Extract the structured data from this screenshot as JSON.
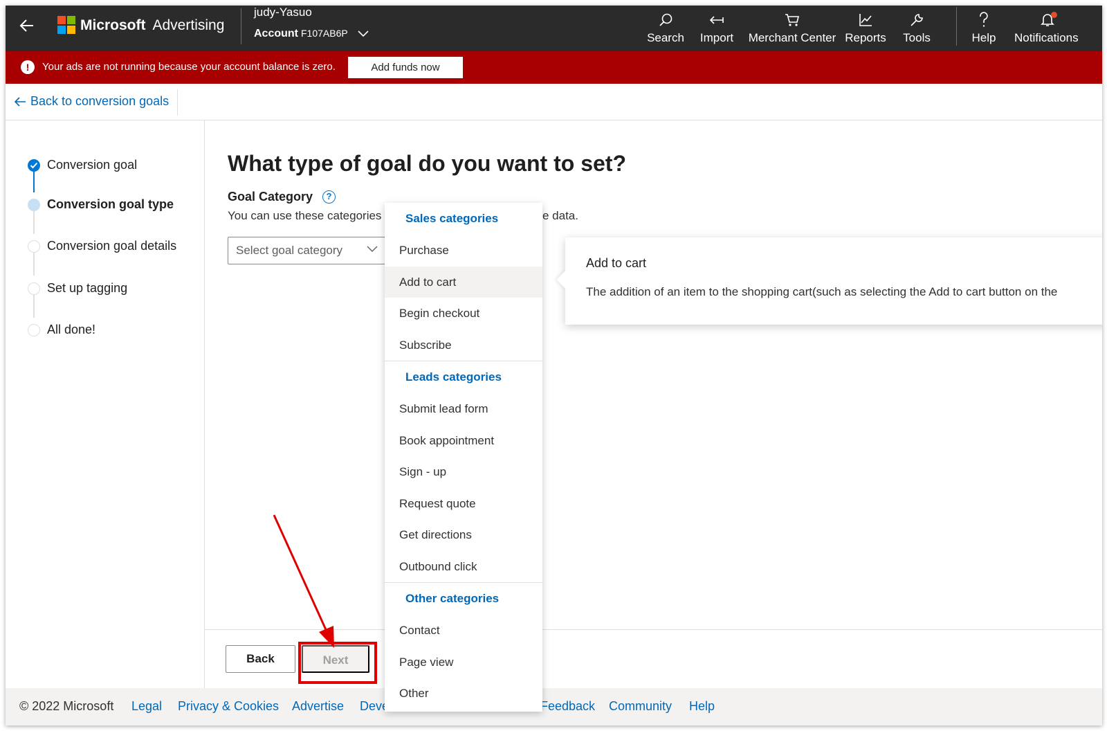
{
  "topbar": {
    "brand_ms": "Microsoft",
    "brand_adv": "Advertising",
    "user": "judy-Yasuo",
    "account_label": "Account",
    "account_id": "F107AB6P",
    "nav": [
      {
        "label": "Search",
        "icon": "search-icon"
      },
      {
        "label": "Import",
        "icon": "import-icon"
      },
      {
        "label": "Merchant Center",
        "icon": "cart-icon"
      },
      {
        "label": "Reports",
        "icon": "chart-icon"
      },
      {
        "label": "Tools",
        "icon": "wrench-icon"
      },
      {
        "label": "Help",
        "icon": "question-icon"
      },
      {
        "label": "Notifications",
        "icon": "bell-icon"
      }
    ]
  },
  "alert": {
    "text": "Your ads are not running because your account balance is zero.",
    "button": "Add funds now",
    "color": "#a80000"
  },
  "backbar": {
    "link": "Back to conversion goals"
  },
  "stepper": {
    "steps": [
      {
        "label": "Conversion goal",
        "state": "done"
      },
      {
        "label": "Conversion goal type",
        "state": "current"
      },
      {
        "label": "Conversion goal details",
        "state": "todo"
      },
      {
        "label": "Set up tagging",
        "state": "todo"
      },
      {
        "label": "All done!",
        "state": "todo"
      }
    ]
  },
  "main": {
    "heading": "What type of goal do you want to set?",
    "category_label": "Goal Category",
    "category_desc_start": "You can use these categories",
    "category_desc_tail": "e data.",
    "select_placeholder": "Select goal category",
    "back_button": "Back",
    "next_button": "Next"
  },
  "dropdown": {
    "groups": [
      {
        "title": "Sales categories",
        "items": [
          "Purchase",
          "Add to cart",
          "Begin checkout",
          "Subscribe"
        ]
      },
      {
        "title": "Leads categories",
        "items": [
          "Submit lead form",
          "Book appointment",
          "Sign - up",
          "Request quote",
          "Get directions",
          "Outbound click"
        ]
      },
      {
        "title": "Other categories",
        "items": [
          "Contact",
          "Page view",
          "Other"
        ]
      }
    ],
    "hovered_item": "Add to cart"
  },
  "callout": {
    "title": "Add to cart",
    "body": "The addition of an item to the shopping cart(such as selecting the Add to cart button on the"
  },
  "footer": {
    "copyright": "© 2022 Microsoft",
    "links": [
      "Legal",
      "Privacy & Cookies",
      "Advertise",
      "Deve",
      "Feedback",
      "Community",
      "Help"
    ]
  },
  "colors": {
    "accent": "#0078d4",
    "link": "#0068b8",
    "topbar": "#2b2b2b",
    "annotation": "#e00000"
  }
}
